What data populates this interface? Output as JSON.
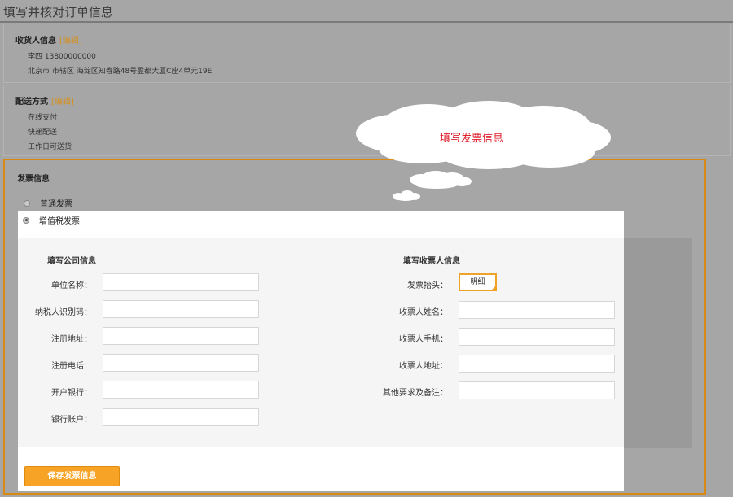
{
  "page_title": "填写并核对订单信息",
  "consignee": {
    "title": "收货人信息",
    "edit": "[编辑]",
    "name_phone": "李四 13800000000",
    "address": "北京市 市辖区 海淀区知春路48号盈都大厦C座4单元19E"
  },
  "delivery": {
    "title": "配送方式",
    "edit": "[编辑]",
    "lines": [
      "在线支付",
      "快递配送",
      "工作日可送货"
    ]
  },
  "invoice": {
    "title": "发票信息",
    "options": [
      {
        "label": "普通发票",
        "checked": false
      },
      {
        "label": "增值税发票",
        "checked": true
      }
    ],
    "company_heading": "填写公司信息",
    "receiver_heading": "填写收票人信息",
    "company_fields": [
      {
        "label": "单位名称：",
        "value": ""
      },
      {
        "label": "纳税人识别码：",
        "value": ""
      },
      {
        "label": "注册地址：",
        "value": ""
      },
      {
        "label": "注册电话：",
        "value": ""
      },
      {
        "label": "开户银行：",
        "value": ""
      },
      {
        "label": "银行账户：",
        "value": ""
      }
    ],
    "header_label": "发票抬头：",
    "header_value": "明细",
    "receiver_fields": [
      {
        "label": "收票人姓名：",
        "value": ""
      },
      {
        "label": "收票人手机：",
        "value": ""
      },
      {
        "label": "收票人地址：",
        "value": ""
      },
      {
        "label": "其他要求及备注：",
        "value": ""
      }
    ],
    "save_button": "保存发票信息"
  },
  "callout": {
    "text": "填写发票信息"
  },
  "colors": {
    "accent": "#f7a325",
    "callout_text": "#e0202c"
  }
}
